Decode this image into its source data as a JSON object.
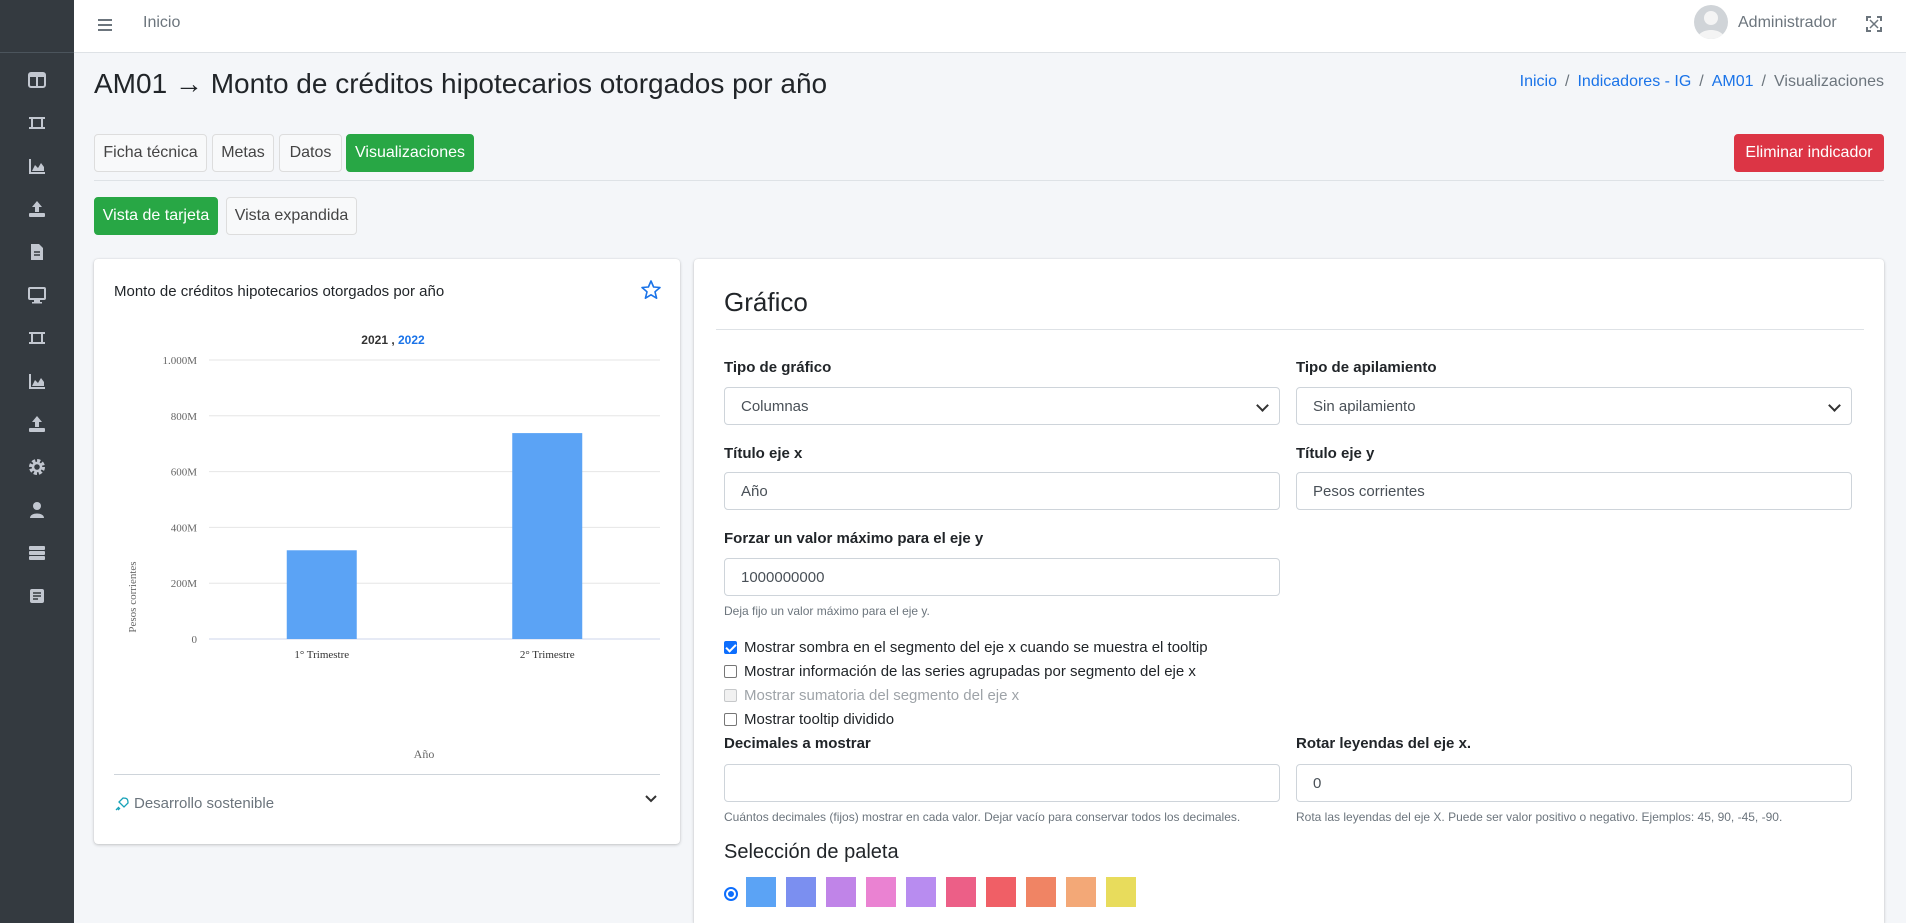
{
  "topbar": {
    "home": "Inicio",
    "user": "Administrador"
  },
  "page": {
    "title": "AM01 → Monto de créditos hipotecarios otorgados por año"
  },
  "breadcrumb": {
    "items": [
      "Inicio",
      "Indicadores - IG",
      "AM01"
    ],
    "current": "Visualizaciones"
  },
  "tabs": [
    "Ficha técnica",
    "Metas",
    "Datos",
    "Visualizaciones"
  ],
  "delete_button": "Eliminar indicador",
  "view_buttons": [
    "Vista de tarjeta",
    "Vista expandida"
  ],
  "chart_card": {
    "title": "Monto de créditos hipotecarios otorgados por año",
    "sdg_label": "Desarrollo sostenible"
  },
  "chart_data": {
    "type": "bar",
    "legend": [
      "2021",
      "2022"
    ],
    "legend_separator": ",",
    "categories": [
      "1° Trimestre",
      "2° Trimestre"
    ],
    "series": [
      {
        "name": "2022",
        "values": [
          318000000,
          738000000
        ]
      }
    ],
    "xlabel": "Año",
    "ylabel": "Pesos corrientes",
    "ylim": [
      0,
      1000000000
    ],
    "yticks": [
      "0",
      "200M",
      "400M",
      "600M",
      "800M",
      "1.000M"
    ],
    "grid": true,
    "color": "#5ba3f5"
  },
  "form": {
    "section_title": "Gráfico",
    "chart_type": {
      "label": "Tipo de gráfico",
      "value": "Columnas"
    },
    "stacking": {
      "label": "Tipo de apilamiento",
      "value": "Sin apilamiento"
    },
    "x_title": {
      "label": "Título eje x",
      "value": "Año"
    },
    "y_title": {
      "label": "Título eje y",
      "value": "Pesos corrientes"
    },
    "y_max": {
      "label": "Forzar un valor máximo para el eje y",
      "value": "1000000000",
      "help": "Deja fijo un valor máximo para el eje y."
    },
    "checkboxes": [
      {
        "label": "Mostrar sombra en el segmento del eje x cuando se muestra el tooltip",
        "checked": true,
        "disabled": false
      },
      {
        "label": "Mostrar información de las series agrupadas por segmento del eje x",
        "checked": false,
        "disabled": false
      },
      {
        "label": "Mostrar sumatoria del segmento del eje x",
        "checked": false,
        "disabled": true
      },
      {
        "label": "Mostrar tooltip dividido",
        "checked": false,
        "disabled": false
      }
    ],
    "decimals": {
      "label": "Decimales a mostrar",
      "value": "",
      "help": "Cuántos decimales (fijos) mostrar en cada valor. Dejar vacío para conservar todos los decimales."
    },
    "rotate": {
      "label": "Rotar leyendas del eje x.",
      "value": "0",
      "help": "Rota las leyendas del eje X. Puede ser valor positivo o negativo. Ejemplos: 45, 90, -45, -90."
    },
    "palette": {
      "title": "Selección de paleta",
      "row1": [
        "#5ba3f5",
        "#7b8ff0",
        "#c084e8",
        "#ea82d2",
        "#b88cf0",
        "#ec5f87",
        "#f05f66",
        "#f08464",
        "#f3a877",
        "#e8dc5c"
      ],
      "row2": [
        "#7fd0f5",
        "#a8c8f5",
        "#e0a8ee",
        "#f09ad8",
        "#ec62a8"
      ]
    }
  }
}
